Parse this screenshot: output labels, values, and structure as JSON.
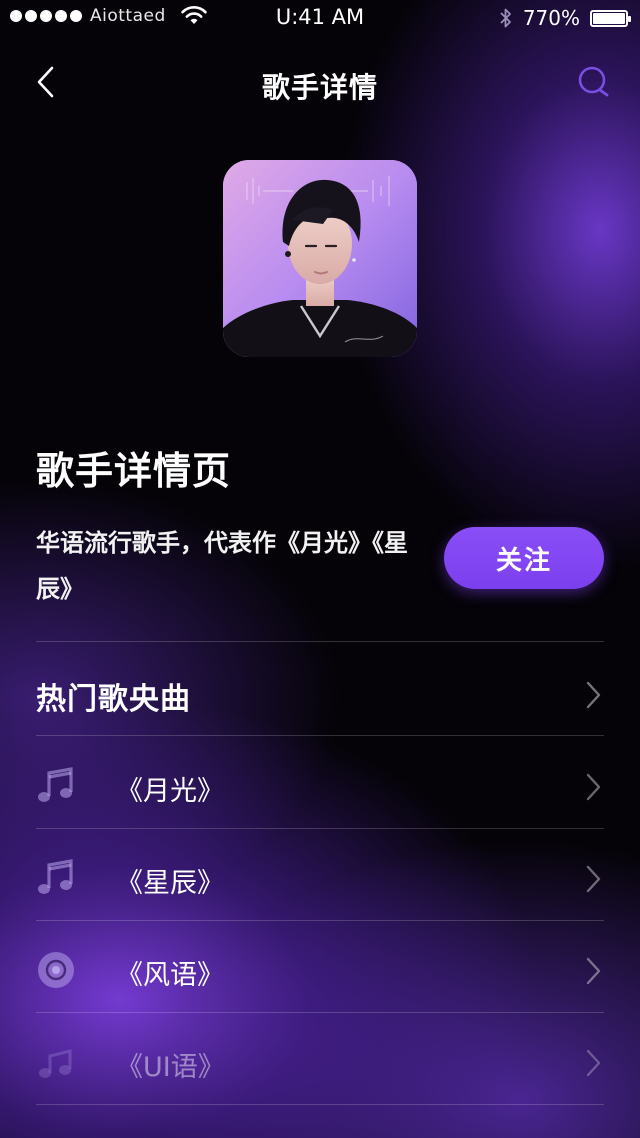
{
  "status_bar": {
    "carrier": "Aiottaed",
    "time": "U:41 AM",
    "battery": "770%"
  },
  "nav": {
    "title": "歌手详情"
  },
  "artist": {
    "name": "歌手详情页",
    "description": "华语流行歌手，代表作《月光》《星辰》",
    "follow_label": "关注"
  },
  "hot_songs": {
    "title": "热门歌央曲",
    "items": [
      {
        "title": "《月光》",
        "icon": "music-note-icon"
      },
      {
        "title": "《星辰》",
        "icon": "music-note-icon"
      },
      {
        "title": "《风语》",
        "icon": "disc-icon"
      },
      {
        "title": "《UI语》",
        "icon": "music-note-icon"
      }
    ]
  },
  "colors": {
    "accent": "#7b3fee",
    "background": "#050308",
    "glow": "#8040e6"
  }
}
